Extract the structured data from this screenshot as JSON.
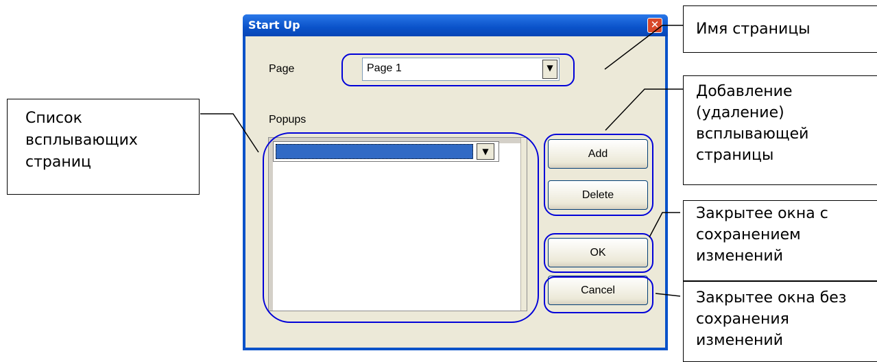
{
  "dialog": {
    "title": "Start Up",
    "close_glyph": "✕",
    "page_label": "Page",
    "page_value": "Page 1",
    "popups_label": "Popups",
    "dropdown_glyph": "▼",
    "buttons": {
      "add": "Add",
      "delete": "Delete",
      "ok": "OK",
      "cancel": "Cancel"
    }
  },
  "annotations": {
    "popup_list": "Список всплывающих страниц",
    "page_name": "Имя страницы",
    "add_delete": "Добавление (удаление) всплывающей страницы",
    "ok_note": "Закрытее окна с сохранением изменений",
    "cancel_note": "Закрытее окна без сохранения изменений"
  },
  "colors": {
    "title_bar": "#0a52c9",
    "highlight": "#0000d8",
    "selection": "#316ac5",
    "dialog_bg": "#ece9d8"
  }
}
